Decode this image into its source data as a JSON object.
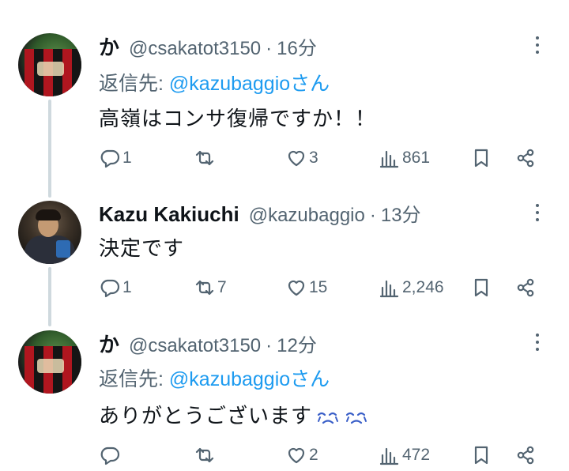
{
  "tweets": [
    {
      "name": "か",
      "handle": "@csakatot3150",
      "separator": "·",
      "time": "16分",
      "reply_prefix": "返信先: ",
      "reply_mention": "@kazubaggio",
      "reply_suffix": "さん",
      "text": "高嶺はコンサ復帰ですか！！",
      "replies": "1",
      "retweets": "",
      "likes": "3",
      "views": "861"
    },
    {
      "name": "Kazu Kakiuchi",
      "handle": "@kazubaggio",
      "separator": "·",
      "time": "13分",
      "text": "決定です",
      "replies": "1",
      "retweets": "7",
      "likes": "15",
      "views": "2,246"
    },
    {
      "name": "か",
      "handle": "@csakatot3150",
      "separator": "·",
      "time": "12分",
      "reply_prefix": "返信先: ",
      "reply_mention": "@kazubaggio",
      "reply_suffix": "さん",
      "text": "ありがとうございます",
      "emoji": [
        "crying-face-emoji",
        "crying-face-emoji"
      ],
      "replies": "",
      "retweets": "",
      "likes": "2",
      "views": "472"
    }
  ],
  "icons": [
    "reply-icon",
    "retweet-icon",
    "like-icon",
    "views-icon",
    "bookmark-icon",
    "share-icon",
    "more-icon"
  ],
  "colors": {
    "link": "#1d9bf0",
    "secondary": "#536471",
    "text": "#0f1419",
    "thread_line": "#cfd9de"
  }
}
